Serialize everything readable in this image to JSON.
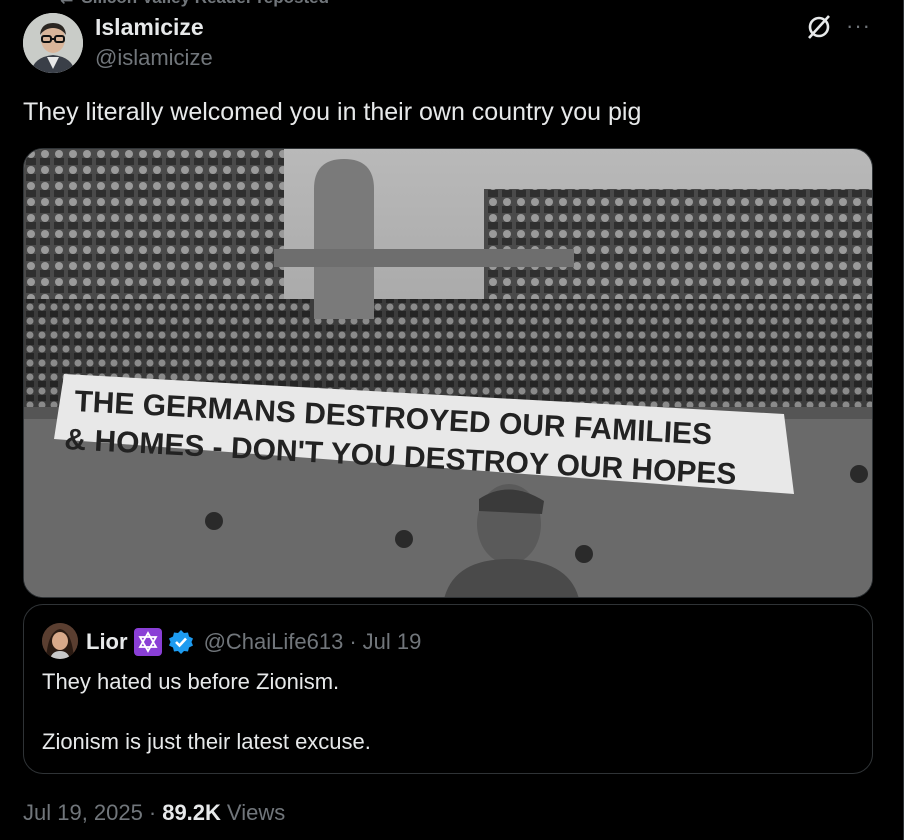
{
  "repost": {
    "label": "Silicon Valley Reader reposted",
    "icon": "repost-icon"
  },
  "author": {
    "name": "Islamicize",
    "handle": "@islamicize",
    "avatar": "avatar"
  },
  "header_icons": {
    "grok": "grok-icon",
    "more": "more-icon",
    "more_glyph": "···"
  },
  "tweet": {
    "text": "They literally welcomed you in their own country you pig"
  },
  "media": {
    "banner_line1": "THE GERMANS DESTROYED OUR FAMILIES",
    "banner_line2": "& HOMES - DON'T YOU DESTROY OUR HOPES"
  },
  "quote": {
    "name": "Lior",
    "emoji": "star-of-david-icon",
    "verified": "verified-badge-icon",
    "handle": "@ChaiLife613",
    "separator": "·",
    "date": "Jul 19",
    "paragraphs": [
      "They hated us before Zionism.",
      "Zionism is just their latest excuse."
    ]
  },
  "meta": {
    "date": "Jul 19, 2025",
    "separator": "·",
    "views_count": "89.2K",
    "views_label": "Views"
  },
  "colors": {
    "background": "#000000",
    "text": "#e7e9ea",
    "secondary": "#71767b",
    "border": "#2f3336",
    "verified": "#1d9bf0",
    "emoji_bg": "#8a3fd6"
  }
}
